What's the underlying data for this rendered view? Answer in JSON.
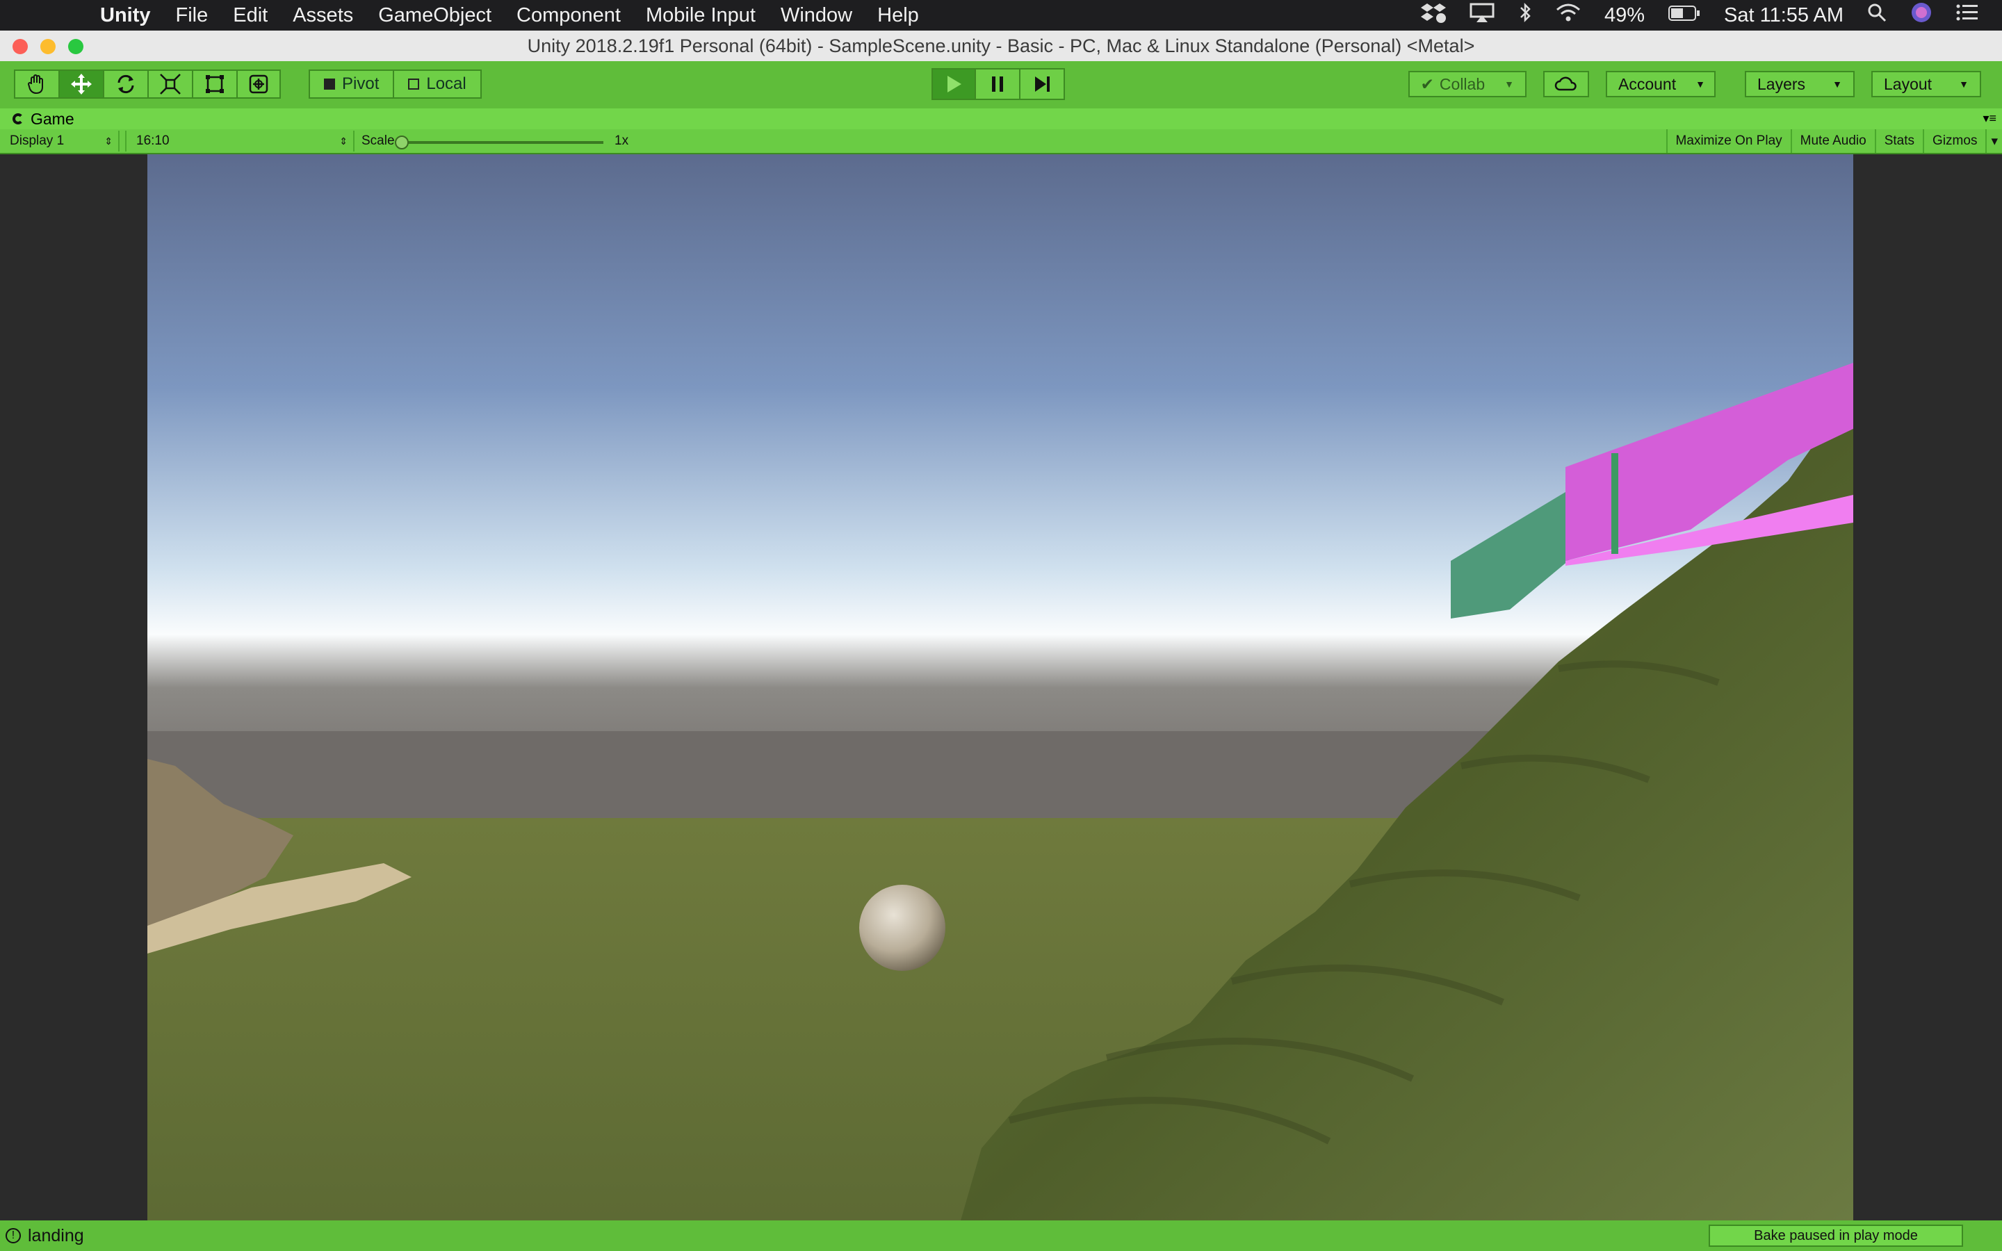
{
  "menubar": {
    "app": "Unity",
    "items": [
      "File",
      "Edit",
      "Assets",
      "GameObject",
      "Component",
      "Mobile Input",
      "Window",
      "Help"
    ],
    "battery": "49%",
    "clock": "Sat 11:55 AM"
  },
  "window": {
    "title": "Unity 2018.2.19f1 Personal (64bit) - SampleScene.unity - Basic - PC, Mac & Linux Standalone (Personal) <Metal>"
  },
  "toolbar": {
    "pivot_label": "Pivot",
    "local_label": "Local",
    "collab_label": "Collab",
    "account_label": "Account",
    "layers_label": "Layers",
    "layout_label": "Layout"
  },
  "game_tab": {
    "label": "Game",
    "display": "Display 1",
    "aspect": "16:10",
    "scale_label": "Scale",
    "scale_value": "1x",
    "maximize": "Maximize On Play",
    "mute": "Mute Audio",
    "stats": "Stats",
    "gizmos": "Gizmos"
  },
  "status": {
    "message": "landing",
    "bake": "Bake paused in play mode"
  },
  "colors": {
    "editor_green": "#5fbd3a",
    "sky_top": "#5d6f95",
    "grass": "#6b7a3c",
    "platform_magenta": "#d45ed8",
    "platform_teal": "#4f9a7a"
  }
}
